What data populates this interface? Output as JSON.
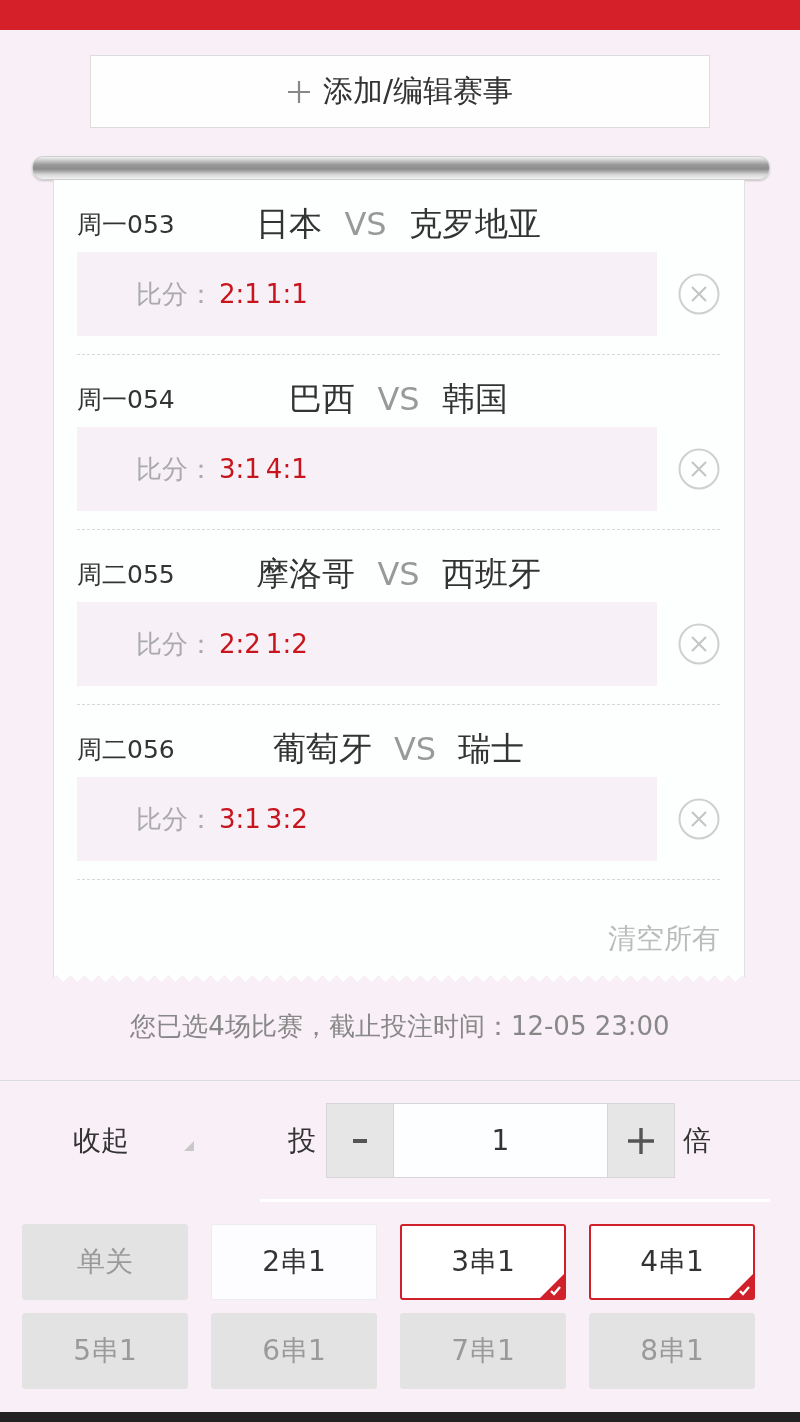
{
  "add_button": {
    "label": "添加/编辑赛事"
  },
  "matches": [
    {
      "code": "周一053",
      "home": "日本",
      "vs": "VS",
      "away": "克罗地亚",
      "score_label": "比分：",
      "scores": [
        "2:1",
        "1:1"
      ]
    },
    {
      "code": "周一054",
      "home": "巴西",
      "vs": "VS",
      "away": "韩国",
      "score_label": "比分：",
      "scores": [
        "3:1",
        "4:1"
      ]
    },
    {
      "code": "周二055",
      "home": "摩洛哥",
      "vs": "VS",
      "away": "西班牙",
      "score_label": "比分：",
      "scores": [
        "2:2",
        "1:2"
      ]
    },
    {
      "code": "周二056",
      "home": "葡萄牙",
      "vs": "VS",
      "away": "瑞士",
      "score_label": "比分：",
      "scores": [
        "3:1",
        "3:2"
      ]
    }
  ],
  "clear_all": "清空所有",
  "summary": "您已选4场比赛，截止投注时间：12-05 23:00",
  "collapse": {
    "label": "收起"
  },
  "multiplier": {
    "prefix": "投",
    "value": "1",
    "suffix": "倍"
  },
  "bet_types": [
    {
      "label": "单关",
      "selected": false,
      "disabled": true
    },
    {
      "label": "2串1",
      "selected": false,
      "disabled": false
    },
    {
      "label": "3串1",
      "selected": true,
      "disabled": false
    },
    {
      "label": "4串1",
      "selected": true,
      "disabled": false
    },
    {
      "label": "5串1",
      "selected": false,
      "disabled": true
    },
    {
      "label": "6串1",
      "selected": false,
      "disabled": true
    },
    {
      "label": "7串1",
      "selected": false,
      "disabled": true
    },
    {
      "label": "8串1",
      "selected": false,
      "disabled": true
    }
  ]
}
